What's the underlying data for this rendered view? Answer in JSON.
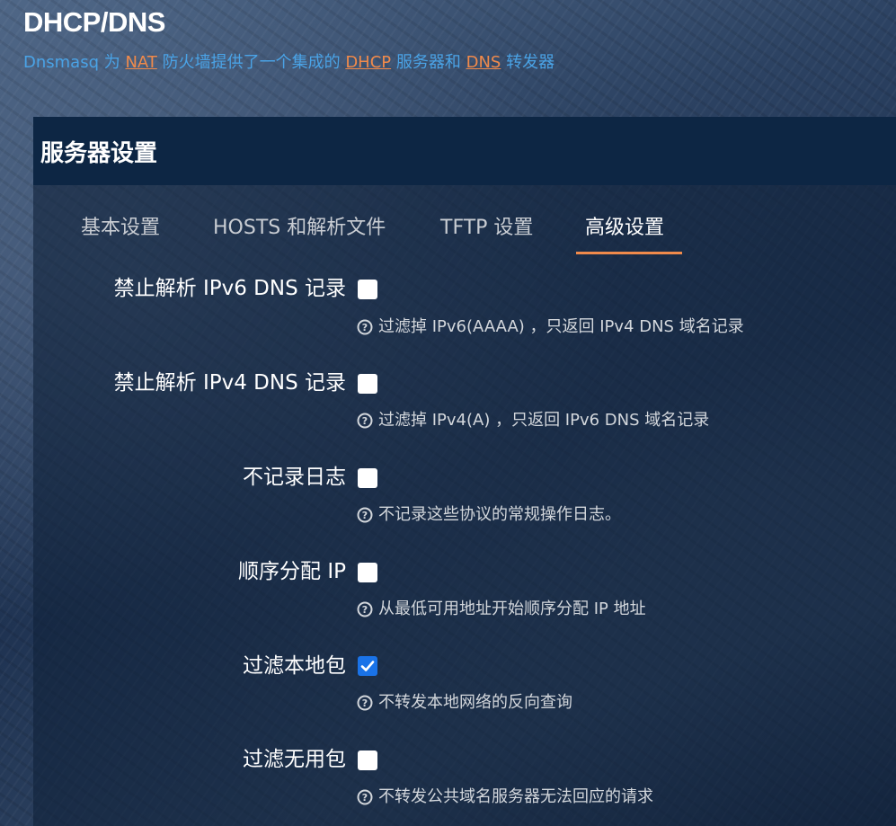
{
  "page": {
    "title": "DHCP/DNS",
    "desc_prefix": "Dnsmasq 为 ",
    "desc_link1": "NAT",
    "desc_mid1": " 防火墙提供了一个集成的 ",
    "desc_link2": "DHCP",
    "desc_mid2": " 服务器和 ",
    "desc_link3": "DNS",
    "desc_suffix": " 转发器"
  },
  "panel": {
    "title": "服务器设置"
  },
  "tabs": [
    {
      "label": "基本设置",
      "active": false
    },
    {
      "label": "HOSTS 和解析文件",
      "active": false
    },
    {
      "label": "TFTP 设置",
      "active": false
    },
    {
      "label": "高级设置",
      "active": true
    }
  ],
  "options": [
    {
      "label": "禁止解析 IPv6 DNS 记录",
      "checked": false,
      "help": "过滤掉 IPv6(AAAA) ，只返回 IPv4 DNS 域名记录"
    },
    {
      "label": "禁止解析 IPv4 DNS 记录",
      "checked": false,
      "help": "过滤掉 IPv4(A) ，只返回 IPv6 DNS 域名记录"
    },
    {
      "label": "不记录日志",
      "checked": false,
      "help": "不记录这些协议的常规操作日志。"
    },
    {
      "label": "顺序分配 IP",
      "checked": false,
      "help": "从最低可用地址开始顺序分配 IP 地址"
    },
    {
      "label": "过滤本地包",
      "checked": true,
      "help": "不转发本地网络的反向查询"
    },
    {
      "label": "过滤无用包",
      "checked": false,
      "help": "不转发公共域名服务器无法回应的请求"
    }
  ],
  "colors": {
    "accent": "#f08a4b",
    "link": "#4aa3e6",
    "checkbox_checked": "#1a73e8",
    "panel_header": "#0d2644"
  }
}
